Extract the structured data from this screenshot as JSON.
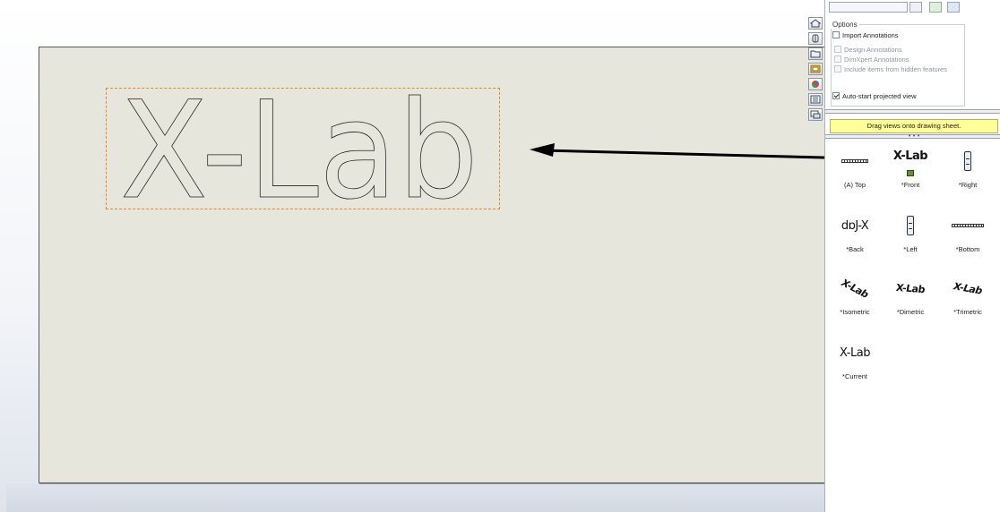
{
  "drawing": {
    "part_text": "X-Lab"
  },
  "toolbar": {
    "icons": [
      "home-icon",
      "3d-view-icon",
      "open-folder-icon",
      "design-library-icon",
      "appearance-icon",
      "custom-properties-icon",
      "view-palette-icon"
    ]
  },
  "options": {
    "legend": "Options",
    "import_annotations": "Import Annotations",
    "design_annotations": "Design Annotations",
    "dimxpert_annotations": "DimXpert Annotations",
    "hidden_features": "Include items from hidden features",
    "auto_start": "Auto-start projected view"
  },
  "palette": {
    "message": "Drag views onto drawing sheet.",
    "views": [
      {
        "label": "(A) Top",
        "thumb": "top"
      },
      {
        "label": "*Front",
        "thumb": "X-Lab"
      },
      {
        "label": "*Right",
        "thumb": "right"
      },
      {
        "label": "*Back",
        "thumb": "dɒJ-X"
      },
      {
        "label": "*Left",
        "thumb": "left"
      },
      {
        "label": "*Bottom",
        "thumb": "bottom"
      },
      {
        "label": "*Isometric",
        "thumb": "X-Lab"
      },
      {
        "label": "*Dimetric",
        "thumb": "X-Lab"
      },
      {
        "label": "*Trimetric",
        "thumb": "X-Lab"
      },
      {
        "label": "*Current",
        "thumb": "X-Lab"
      }
    ]
  },
  "colors": {
    "sheet": "#e7e6dc",
    "selection_box": "#e08a2a",
    "message_bg": "#ffff99"
  }
}
